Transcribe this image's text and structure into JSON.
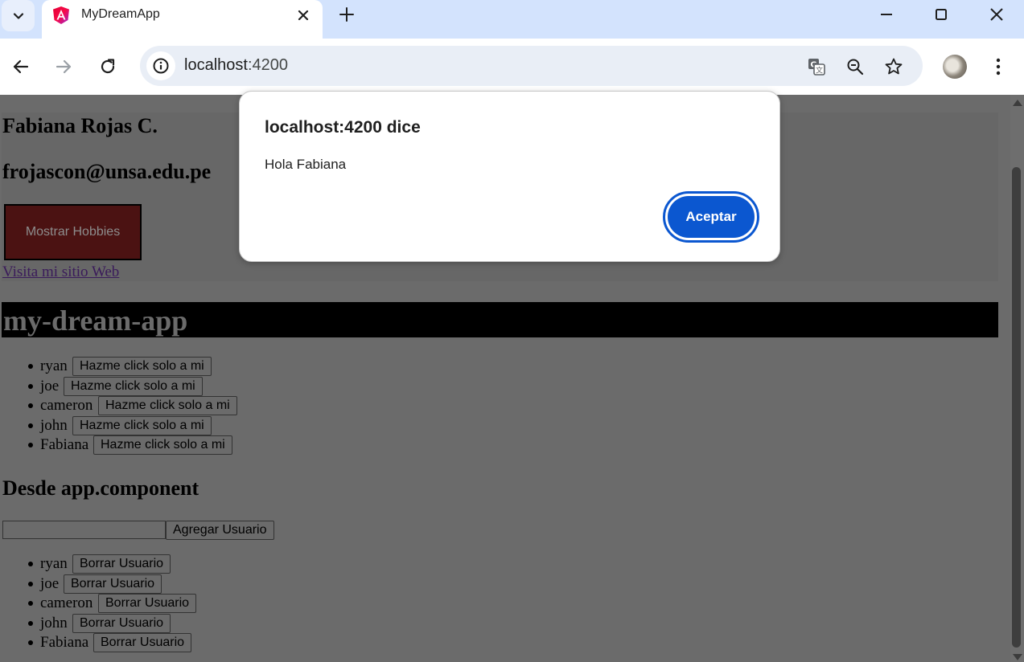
{
  "browser": {
    "tab_title": "MyDreamApp",
    "url_host": "localhost",
    "url_port": ":4200"
  },
  "page": {
    "name": "Fabiana Rojas C.",
    "email": "frojascon@unsa.edu.pe",
    "hobbies_button": "Mostrar Hobbies",
    "web_link": "Visita mi sitio Web",
    "app_title": "my-dream-app",
    "click_list": [
      {
        "name": "ryan",
        "button": "Hazme click solo a mi"
      },
      {
        "name": "joe",
        "button": "Hazme click solo a mi"
      },
      {
        "name": "cameron",
        "button": "Hazme click solo a mi"
      },
      {
        "name": "john",
        "button": "Hazme click solo a mi"
      },
      {
        "name": "Fabiana",
        "button": "Hazme click solo a mi"
      }
    ],
    "section_title": "Desde app.component",
    "input_value": "",
    "add_button": "Agregar Usuario",
    "delete_list": [
      {
        "name": "ryan",
        "button": "Borrar Usuario"
      },
      {
        "name": "joe",
        "button": "Borrar Usuario"
      },
      {
        "name": "cameron",
        "button": "Borrar Usuario"
      },
      {
        "name": "john",
        "button": "Borrar Usuario"
      },
      {
        "name": "Fabiana",
        "button": "Borrar Usuario"
      }
    ]
  },
  "dialog": {
    "title": "localhost:4200 dice",
    "message": "Hola Fabiana",
    "ok_button": "Aceptar"
  },
  "colors": {
    "accent": "#0b57d0",
    "tabbar": "#d3e3fd",
    "overlay_page": "#6b6b6b"
  },
  "icons": [
    "tab-search-icon",
    "angular-icon",
    "close-icon",
    "plus-icon",
    "minimize-icon",
    "maximize-icon",
    "window-close-icon",
    "back-arrow-icon",
    "forward-arrow-icon",
    "reload-icon",
    "info-icon",
    "translate-icon",
    "zoom-icon",
    "star-icon",
    "kebab-menu-icon"
  ]
}
